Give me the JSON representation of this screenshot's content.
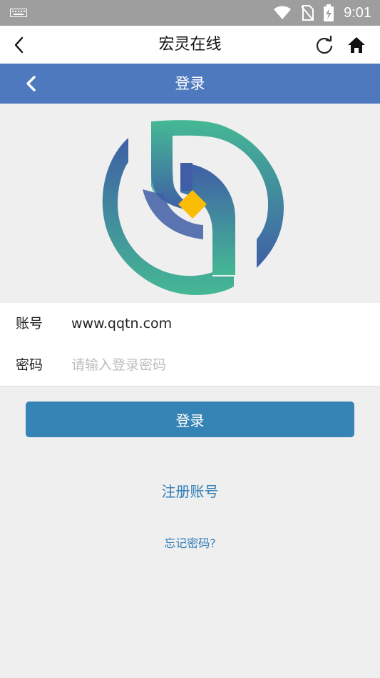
{
  "status_bar": {
    "time": "9:01",
    "icons": [
      "keyboard-icon",
      "wifi-icon",
      "no-sim-icon",
      "battery-charging-icon"
    ]
  },
  "app_bar": {
    "title": "宏灵在线",
    "icons": [
      "back-arrow-icon",
      "refresh-icon",
      "home-icon"
    ]
  },
  "page_header": {
    "title": "登录",
    "icons": [
      "back-chevron-icon"
    ]
  },
  "logo": {
    "colors": {
      "gradient_start": "#45b894",
      "gradient_end": "#3f5ea6",
      "diamond": "#fbbc05"
    }
  },
  "form": {
    "account": {
      "label": "账号",
      "value": "www.qqtn.com"
    },
    "password": {
      "label": "密码",
      "placeholder": "请输入登录密码"
    }
  },
  "login_button": {
    "label": "登录"
  },
  "register_link": {
    "label": "注册账号"
  },
  "forgot_link": {
    "label": "忘记密码?"
  },
  "colors": {
    "header_bg": "#4f79bf",
    "button_bg": "#3683b5",
    "link": "#2f7db5",
    "page_bg": "#efefef"
  }
}
